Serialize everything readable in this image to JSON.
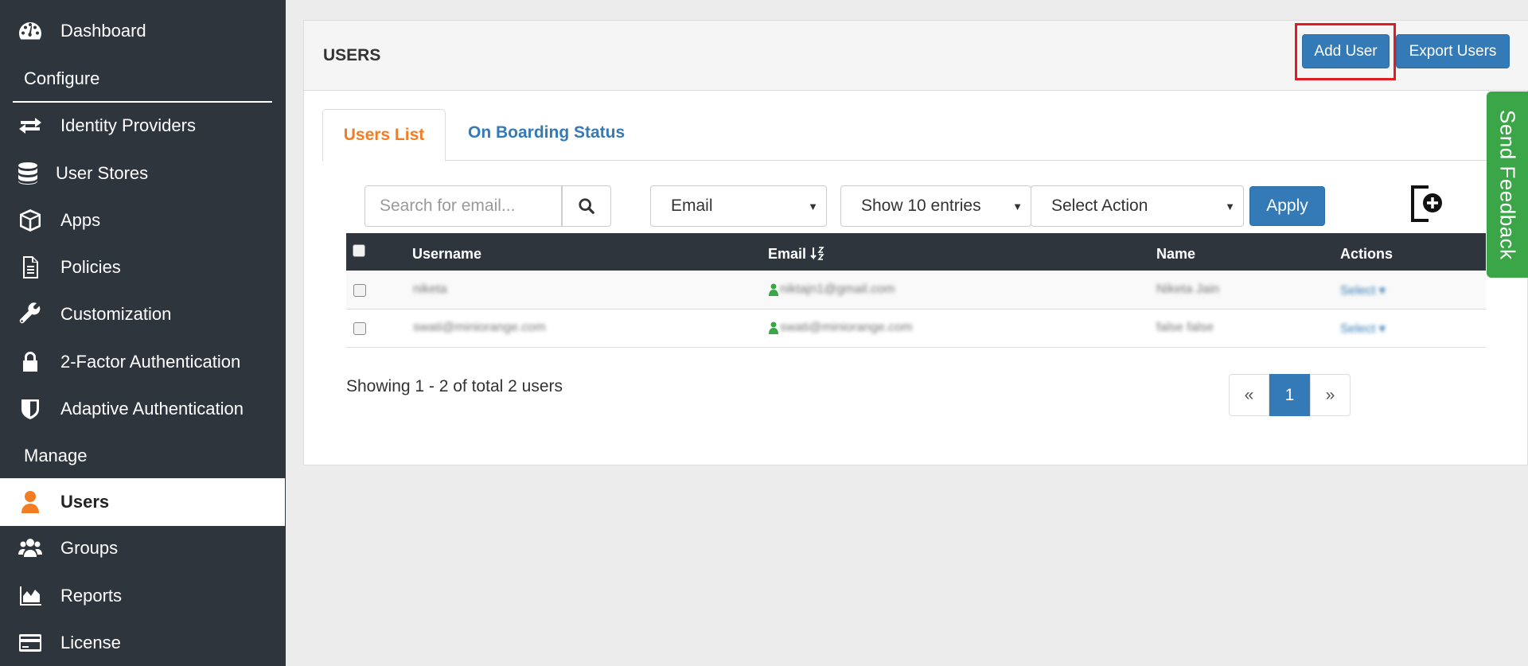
{
  "sidebar": {
    "items": [
      {
        "label": "Dashboard",
        "icon": "dashboard-icon"
      },
      {
        "label": "Identity Providers",
        "icon": "exchange-icon"
      },
      {
        "label": "User Stores",
        "icon": "database-icon"
      },
      {
        "label": "Apps",
        "icon": "cube-icon"
      },
      {
        "label": "Policies",
        "icon": "document-icon"
      },
      {
        "label": "Customization",
        "icon": "wrench-icon"
      },
      {
        "label": "2-Factor Authentication",
        "icon": "lock-icon"
      },
      {
        "label": "Adaptive Authentication",
        "icon": "shield-icon"
      },
      {
        "label": "Users",
        "icon": "user-icon",
        "active": true
      },
      {
        "label": "Groups",
        "icon": "users-icon"
      },
      {
        "label": "Reports",
        "icon": "area-chart-icon"
      },
      {
        "label": "License",
        "icon": "credit-card-icon"
      }
    ],
    "section_configure": "Configure",
    "section_manage": "Manage"
  },
  "panel": {
    "title": "USERS",
    "add_user": "Add User",
    "export_users": "Export Users"
  },
  "tabs": {
    "users_list": "Users List",
    "onboarding": "On Boarding Status"
  },
  "toolbar": {
    "search_placeholder": "Search for email...",
    "filter_field": "Email",
    "entries": "Show 10 entries",
    "action": "Select Action",
    "apply": "Apply"
  },
  "table": {
    "headers": {
      "username": "Username",
      "email": "Email",
      "name": "Name",
      "actions": "Actions"
    },
    "rows": [
      {
        "username": "niketa",
        "email": "niktajn1@gmail.com",
        "name": "Niketa Jain",
        "action": "Select ▾"
      },
      {
        "username": "swati@miniorange.com",
        "email": "swati@miniorange.com",
        "name": "false false",
        "action": "Select ▾"
      }
    ]
  },
  "footer": {
    "showing": "Showing 1 - 2 of total 2 users",
    "prev": "«",
    "page": "1",
    "next": "»"
  },
  "feedback": "Send Feedback",
  "colors": {
    "sidebar_bg": "#2f353d",
    "accent_orange": "#f27d22",
    "primary_blue": "#337ab7",
    "feedback_green": "#3aa648",
    "highlight_red": "#e01b23"
  }
}
